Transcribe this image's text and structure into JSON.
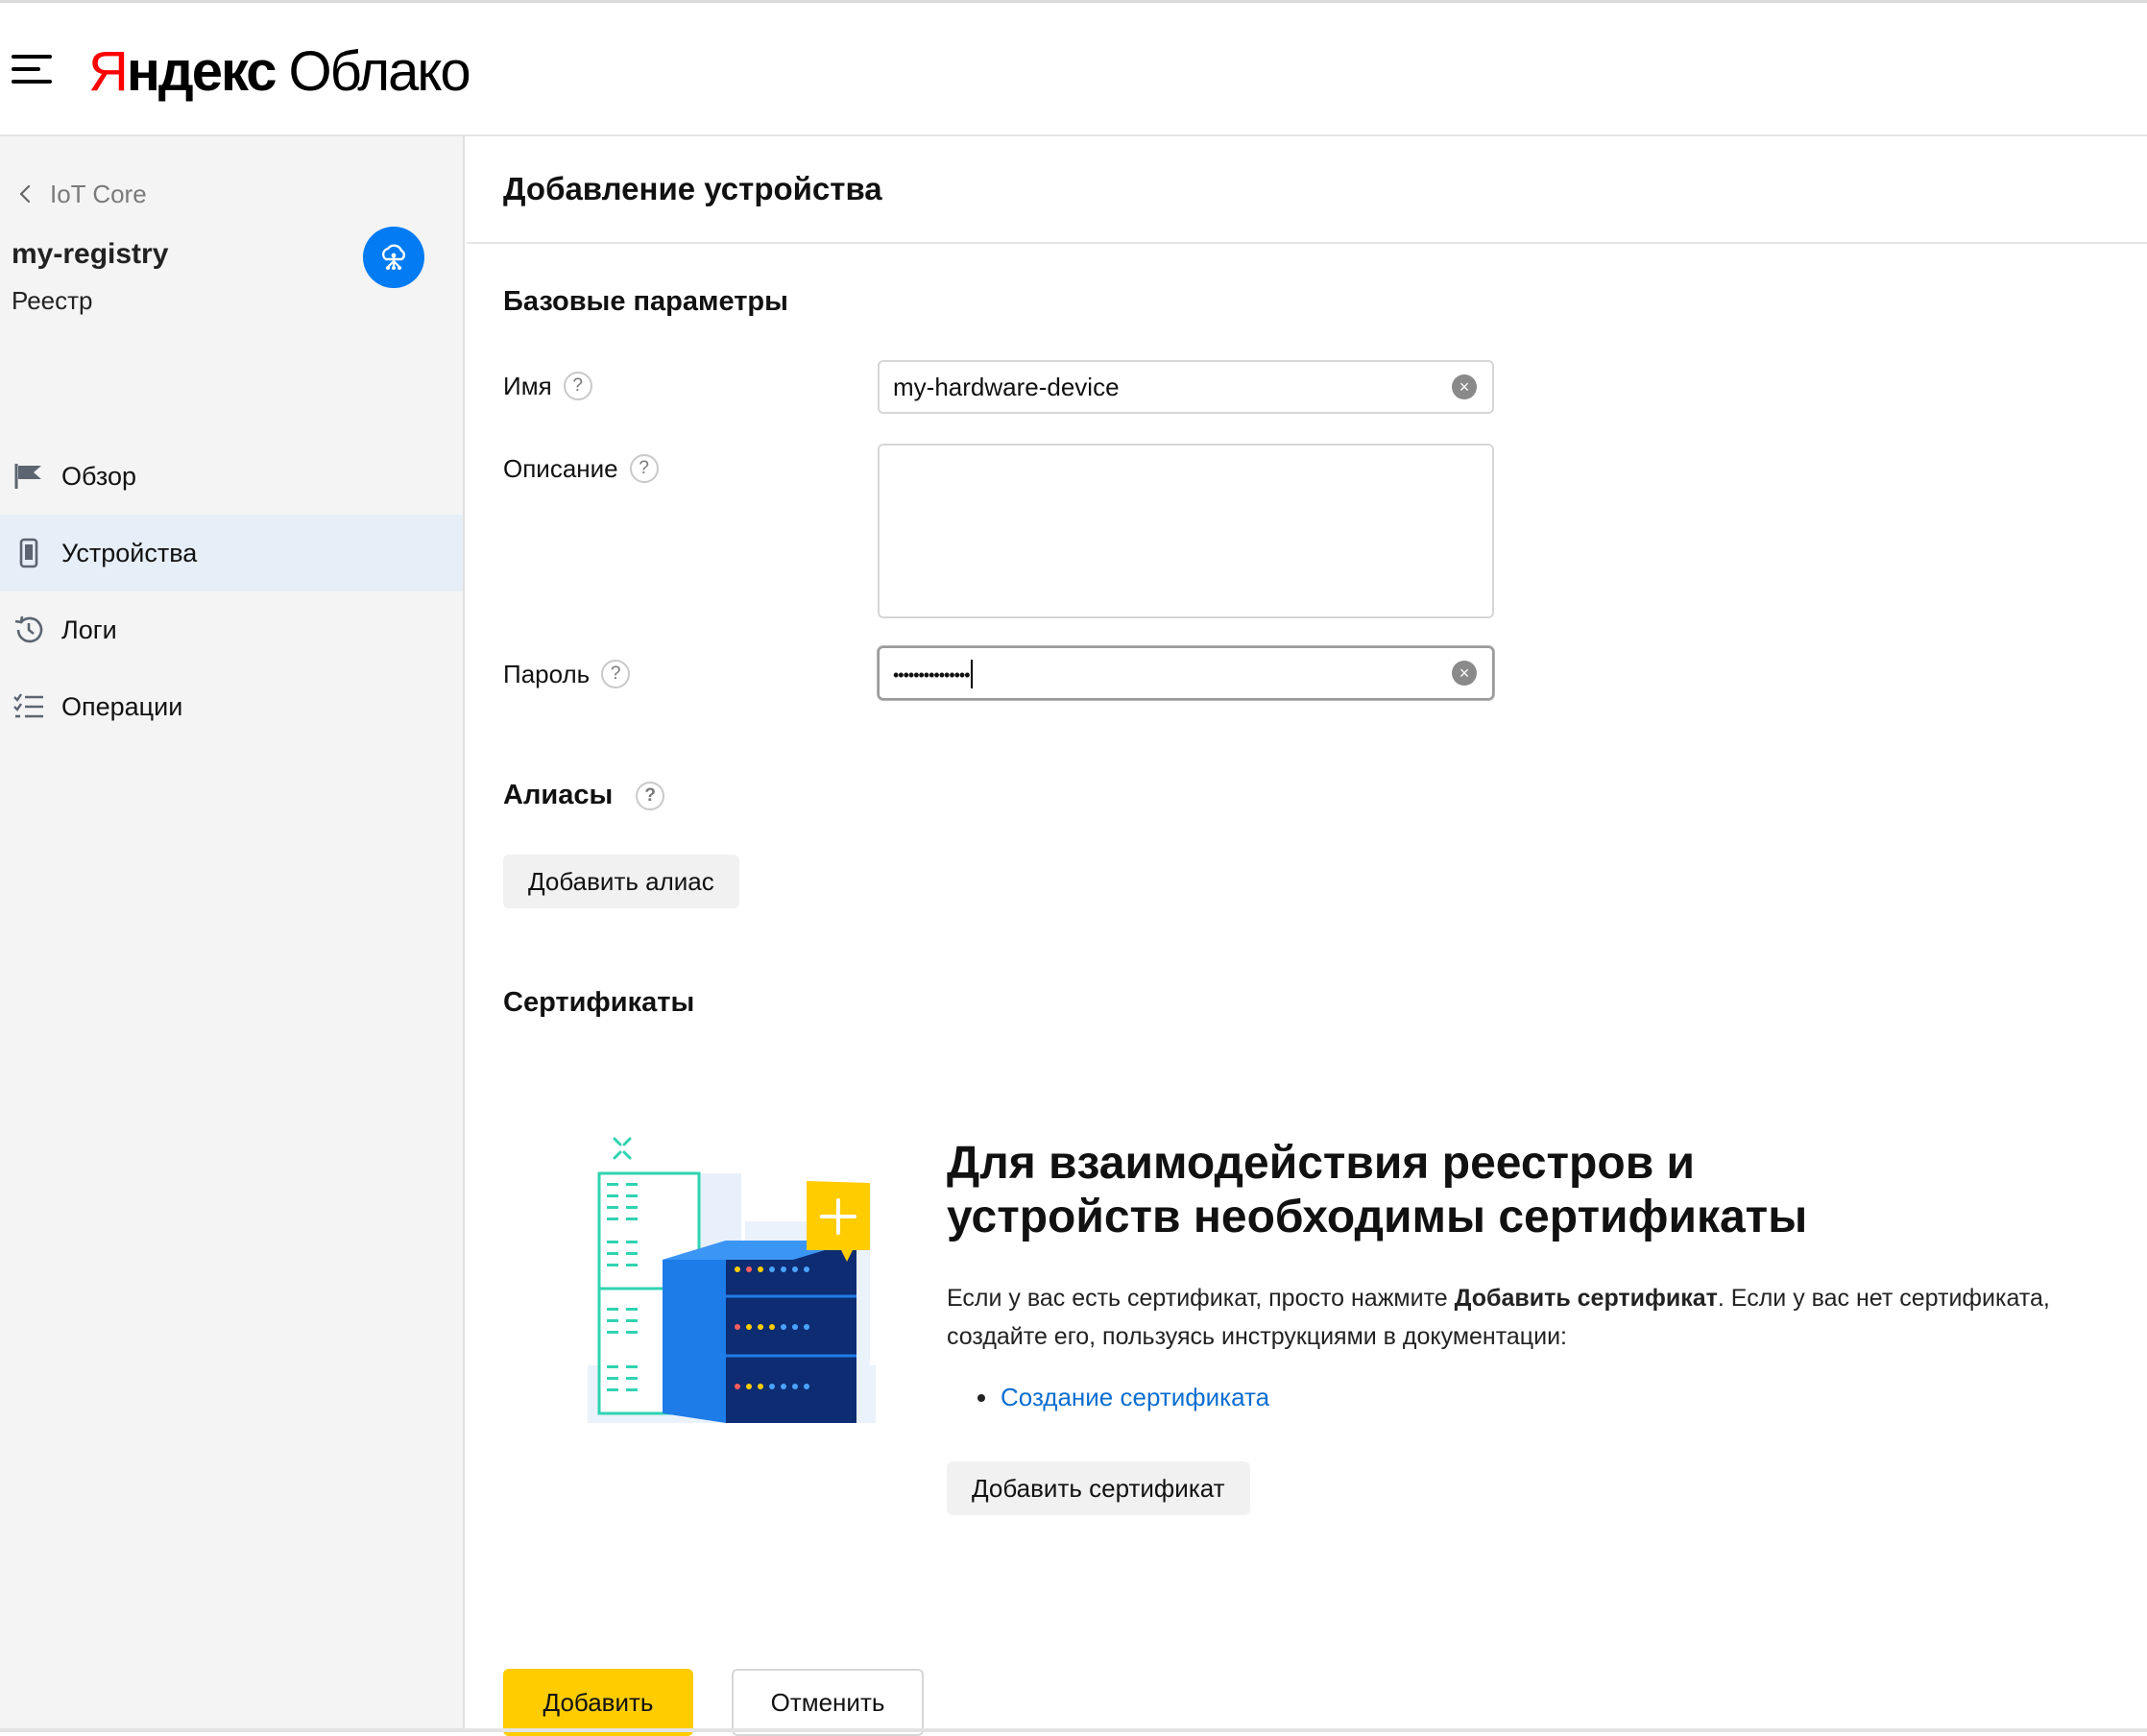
{
  "header": {
    "logo_y": "Я",
    "logo_rest": "ндекс",
    "logo_cloud": "Облако"
  },
  "sidebar": {
    "back_label": "IoT Core",
    "registry_name": "my-registry",
    "registry_type": "Реестр",
    "items": [
      {
        "label": "Обзор",
        "icon": "flag-icon",
        "active": false
      },
      {
        "label": "Устройства",
        "icon": "device-icon",
        "active": true
      },
      {
        "label": "Логи",
        "icon": "history-icon",
        "active": false
      },
      {
        "label": "Операции",
        "icon": "list-icon",
        "active": false
      }
    ]
  },
  "main": {
    "title": "Добавление устройства",
    "basic_section": "Базовые параметры",
    "name_label": "Имя",
    "name_value": "my-hardware-device",
    "description_label": "Описание",
    "description_value": "",
    "password_label": "Пароль",
    "password_value": "•••••••••••••••",
    "aliases_section": "Алиасы",
    "add_alias": "Добавить алиас",
    "certs_section": "Сертификаты",
    "certs_title": "Для взаимодействия реестров и устройств необходимы сертификаты",
    "certs_text_1": "Если у вас есть сертификат, просто нажмите ",
    "certs_text_bold": "Добавить сертификат",
    "certs_text_2": ". Если у вас нет сертификата, создайте его, пользуясь инструкциями в документации:",
    "certs_link": "Создание сертификата",
    "add_cert": "Добавить сертификат",
    "submit": "Добавить",
    "cancel": "Отменить"
  },
  "colors": {
    "accent_blue": "#027bf3",
    "primary_yellow": "#ffcc00",
    "link": "#0a6ed1",
    "logo_red": "#ff0000"
  }
}
